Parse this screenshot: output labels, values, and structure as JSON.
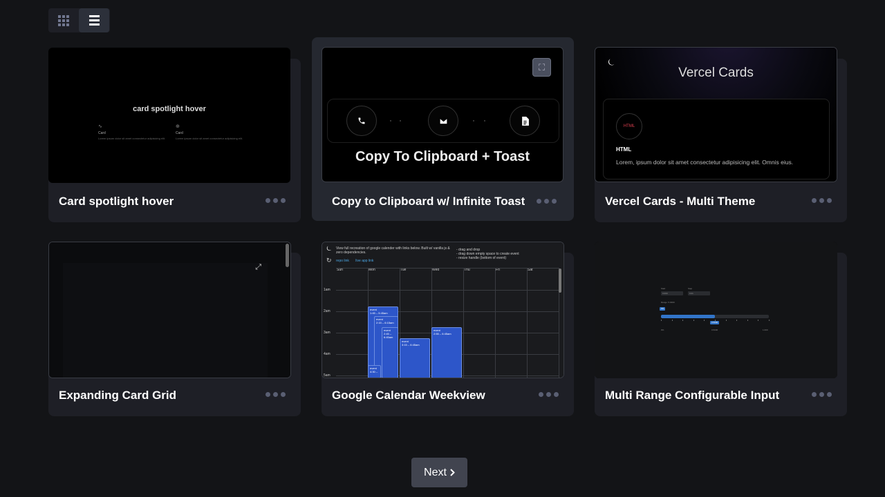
{
  "toolbar": {
    "grid_view_icon": "grid-icon",
    "list_view_icon": "list-icon",
    "active_view": "list"
  },
  "cards": [
    {
      "title": "Card spotlight hover",
      "preview": {
        "heading": "card spotlight hover",
        "items": [
          {
            "icon": "∿",
            "title": "Card",
            "text": "Lorem ipsum dolor sit amet consectetur adipisicing elit."
          },
          {
            "icon": "⊕",
            "title": "Card",
            "text": "Lorem ipsum dolor sit amet consectetur adipisicing elit."
          }
        ]
      }
    },
    {
      "title": "Copy to Clipboard w/ Infinite Toast",
      "preview": {
        "heading": "Copy To Clipboard + Toast",
        "expand_icon": "⛶",
        "icons": [
          "📞",
          "✉",
          "🗎"
        ]
      }
    },
    {
      "title": "Vercel Cards - Multi Theme",
      "preview": {
        "heading": "Vercel Cards",
        "moon_icon": "⏾",
        "badge": "HTML",
        "card_title": "HTML",
        "card_text": "Lorem, ipsum dolor sit amet consectetur adipisicing elit. Omnis eius."
      }
    },
    {
      "title": "Expanding Card Grid",
      "preview": {
        "expand_icon": "⤢"
      }
    },
    {
      "title": "Google Calendar Weekview",
      "preview": {
        "moon_icon": "⏾",
        "refresh_icon": "↻",
        "intro": "View full recreation of google calender with links below. Built w/ vanilla js & zero dependencies.",
        "links": [
          "repo link",
          "live app link"
        ],
        "notes": [
          "- drag and drop",
          "- drag down empty space to create event",
          "- resize handle (bottom of event)"
        ],
        "days": [
          "Sun",
          "Mon",
          "Tue",
          "Wed",
          "Thu",
          "Fri",
          "Sat"
        ],
        "times": [
          "1am",
          "2am",
          "3am",
          "4am",
          "5am"
        ],
        "events": [
          {
            "label": "event",
            "time": "1:45 – 5:45am"
          },
          {
            "label": "event",
            "time": "2:15 – 6:15am"
          },
          {
            "label": "event",
            "time": "2:45 – 6:45am"
          },
          {
            "label": "event",
            "time": "3:15 – 6:45am"
          },
          {
            "label": "event",
            "time": "2:55 – 6:45am"
          },
          {
            "label": "event",
            "time": "4:30 –"
          }
        ]
      }
    },
    {
      "title": "Multi Range Configurable Input",
      "preview": {
        "labels": [
          "Start",
          "Step"
        ],
        "values": [
          "0.000",
          "0.01"
        ],
        "range_label": "Range: 5.0000",
        "tip_low": "0%",
        "tip_high": "0.5000",
        "axis": [
          "0%",
          "0.5000",
          "1.000"
        ],
        "progress": 0.5
      }
    }
  ],
  "pagination": {
    "next_label": "Next",
    "next_icon": "chevron-right-icon"
  }
}
